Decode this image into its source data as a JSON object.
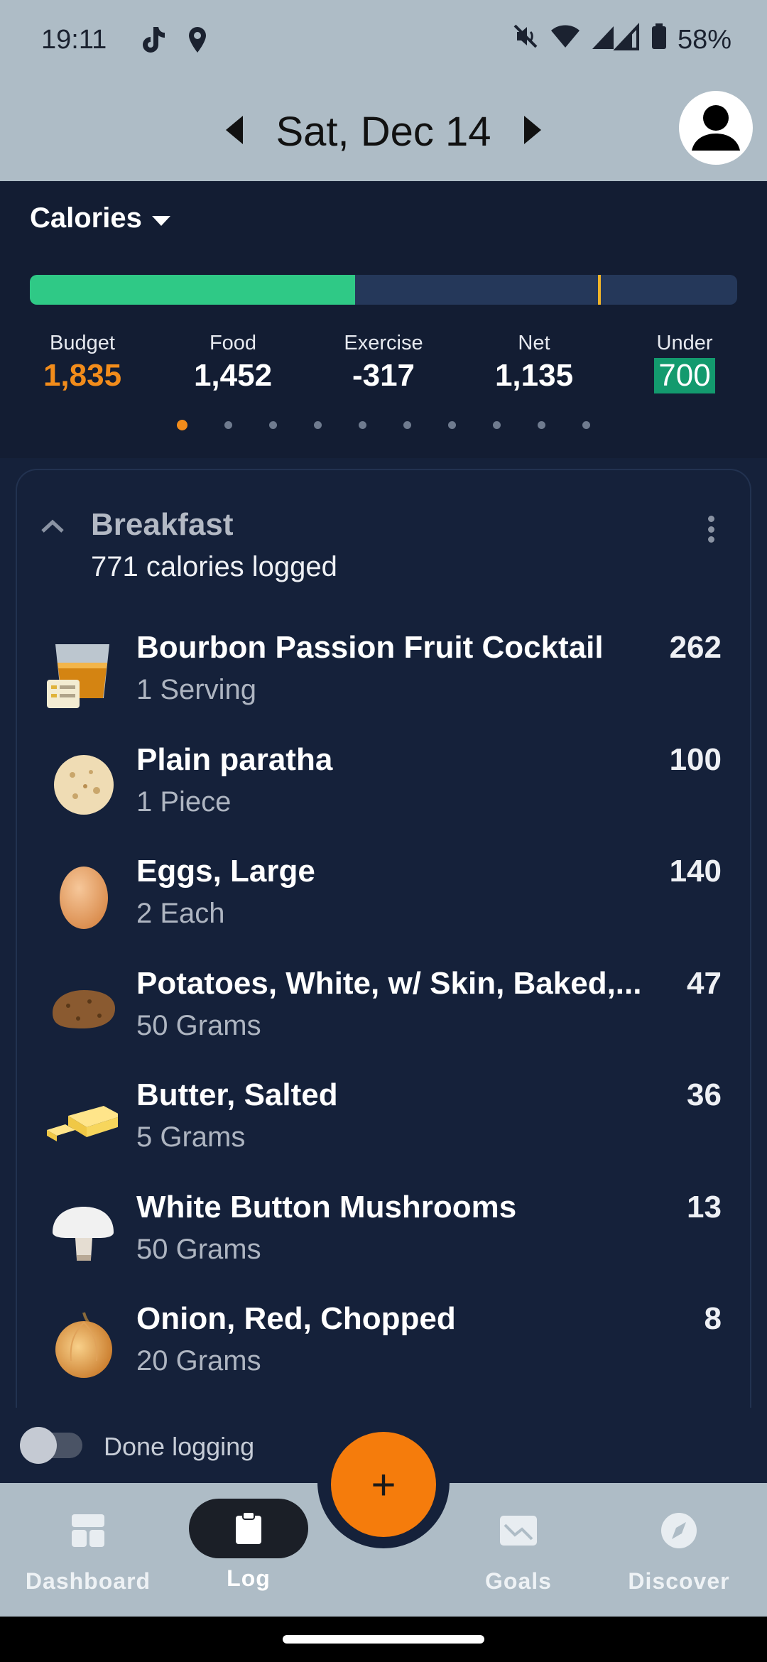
{
  "status_bar": {
    "time": "19:11",
    "battery": "58%",
    "left_icons": [
      "tiktok-icon",
      "location-icon"
    ],
    "right_icons": [
      "mute-icon",
      "wifi-icon",
      "signal-icon",
      "battery-icon"
    ]
  },
  "header": {
    "date": "Sat, Dec 14"
  },
  "summary": {
    "metric": "Calories",
    "progress_fraction": 0.46,
    "marker_fraction": 0.803,
    "colors": {
      "fill": "#2fc986",
      "track": "#25385a",
      "marker": "#f0b429",
      "budget": "#f28c1b",
      "under_badge": "#139a6e"
    },
    "stats": [
      {
        "label": "Budget",
        "value": "1,835"
      },
      {
        "label": "Food",
        "value": "1,452"
      },
      {
        "label": "Exercise",
        "value": "-317"
      },
      {
        "label": "Net",
        "value": "1,135"
      },
      {
        "label": "Under",
        "value": "700"
      }
    ],
    "page_count": 10,
    "active_page": 1
  },
  "meal": {
    "title": "Breakfast",
    "subtitle": "771 calories logged",
    "items": [
      {
        "name": "Bourbon Passion Fruit Cocktail",
        "serving": "1 Serving",
        "calories": "262",
        "icon": "cocktail-icon"
      },
      {
        "name": "Plain paratha",
        "serving": "1 Piece",
        "calories": "100",
        "icon": "paratha-icon"
      },
      {
        "name": "Eggs, Large",
        "serving": "2 Each",
        "calories": "140",
        "icon": "egg-icon"
      },
      {
        "name": "Potatoes, White, w/ Skin, Baked,...",
        "serving": "50 Grams",
        "calories": "47",
        "icon": "potato-icon"
      },
      {
        "name": "Butter, Salted",
        "serving": "5 Grams",
        "calories": "36",
        "icon": "butter-icon"
      },
      {
        "name": "White Button Mushrooms",
        "serving": "50 Grams",
        "calories": "13",
        "icon": "mushroom-icon"
      },
      {
        "name": "Onion, Red, Chopped",
        "serving": "20 Grams",
        "calories": "8",
        "icon": "onion-icon"
      }
    ]
  },
  "done_logging": {
    "label": "Done logging",
    "enabled": false
  },
  "fab": {
    "label": "+"
  },
  "nav": [
    {
      "label": "Dashboard",
      "icon": "dashboard-icon"
    },
    {
      "label": "Log",
      "icon": "clipboard-icon",
      "active": true
    },
    {
      "label": "Goals",
      "icon": "goals-icon"
    },
    {
      "label": "Discover",
      "icon": "compass-icon"
    }
  ]
}
